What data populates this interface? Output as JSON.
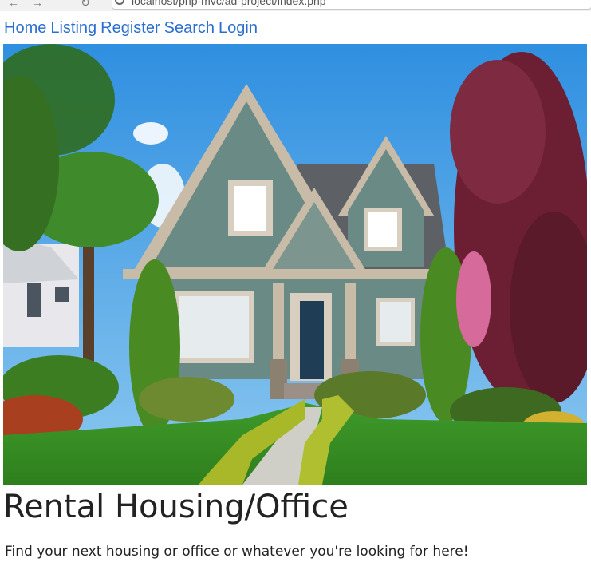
{
  "browser": {
    "back_icon": "back-arrow-icon",
    "forward_icon": "forward-arrow-icon",
    "reload_icon": "reload-icon",
    "address_text": "localhost/php-mvc/ad-project/index.php"
  },
  "nav": {
    "links": [
      {
        "label": "Home"
      },
      {
        "label": "Listing"
      },
      {
        "label": "Register"
      },
      {
        "label": "Search"
      },
      {
        "label": "Login"
      }
    ],
    "link_color": "#2a6fd0"
  },
  "hero": {
    "image": "house-photo"
  },
  "main": {
    "title": "Rental Housing/Office",
    "subtitle": "Find your next housing or office or whatever you're looking for here!"
  }
}
